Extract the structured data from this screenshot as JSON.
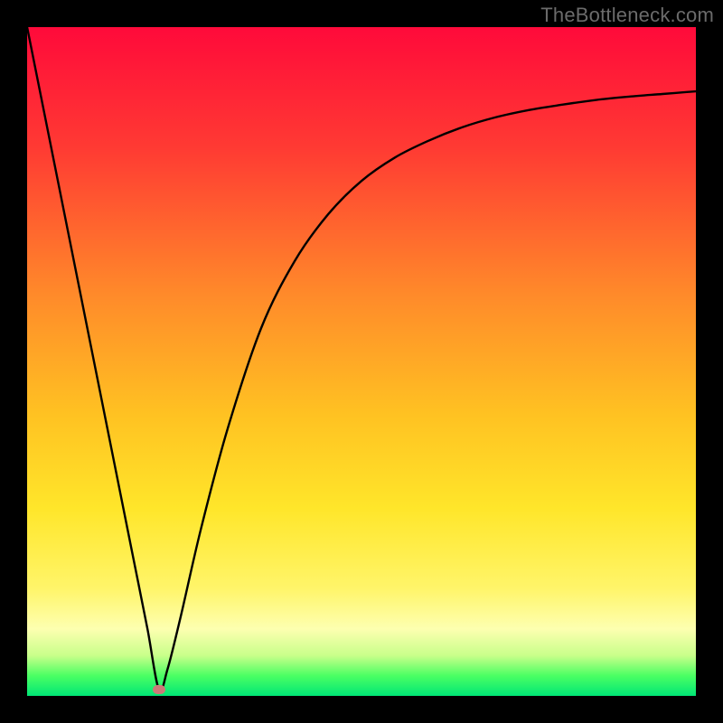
{
  "watermark": "TheBottleneck.com",
  "colors": {
    "frame": "#000000",
    "curve_stroke": "#000000",
    "marker_fill": "#cc7a78",
    "gradient_stops": [
      "#ff0a3a",
      "#ff3a33",
      "#ff8a2a",
      "#ffc222",
      "#ffe62a",
      "#fff56a",
      "#fdffb0",
      "#c8ff8a",
      "#4aff63",
      "#00e676"
    ]
  },
  "chart_data": {
    "type": "line",
    "title": "",
    "xlabel": "",
    "ylabel": "",
    "xlim": [
      0,
      100
    ],
    "ylim": [
      0,
      100
    ],
    "grid": false,
    "legend": false,
    "series": [
      {
        "name": "curve",
        "x": [
          0,
          2,
          4,
          6,
          8,
          10,
          12,
          14,
          16,
          18,
          19.7,
          21,
          23,
          26,
          30,
          35,
          40,
          45,
          50,
          55,
          60,
          65,
          70,
          75,
          80,
          85,
          90,
          95,
          100
        ],
        "y": [
          100,
          90,
          80,
          70,
          60,
          50,
          40,
          30,
          20,
          10,
          1,
          4,
          12,
          25,
          40,
          55,
          65,
          72,
          77,
          80.5,
          83,
          85,
          86.5,
          87.6,
          88.4,
          89.1,
          89.6,
          90,
          90.4
        ]
      }
    ],
    "marker": {
      "x": 19.7,
      "y": 1
    }
  }
}
